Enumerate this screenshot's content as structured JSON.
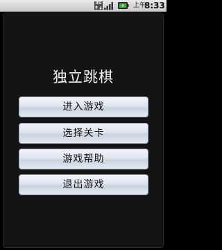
{
  "status_bar": {
    "network_label": "3G",
    "ampm": "上午",
    "time": "8:33",
    "icons": [
      "network-3g-icon",
      "signal-icon",
      "battery-icon"
    ]
  },
  "app": {
    "title": "独立跳棋"
  },
  "menu": {
    "items": [
      {
        "label": "进入游戏"
      },
      {
        "label": "选择关卡"
      },
      {
        "label": "游戏帮助"
      },
      {
        "label": "退出游戏"
      }
    ]
  },
  "colors": {
    "background": "#000000",
    "panel": "#141414",
    "title_text": "#f2f2f2",
    "button_top": "#f1f4f9",
    "button_bottom": "#cbd3e0",
    "button_border": "#9aa3b3",
    "status_bar": "#d9d9d9",
    "battery": "#3cb043"
  }
}
